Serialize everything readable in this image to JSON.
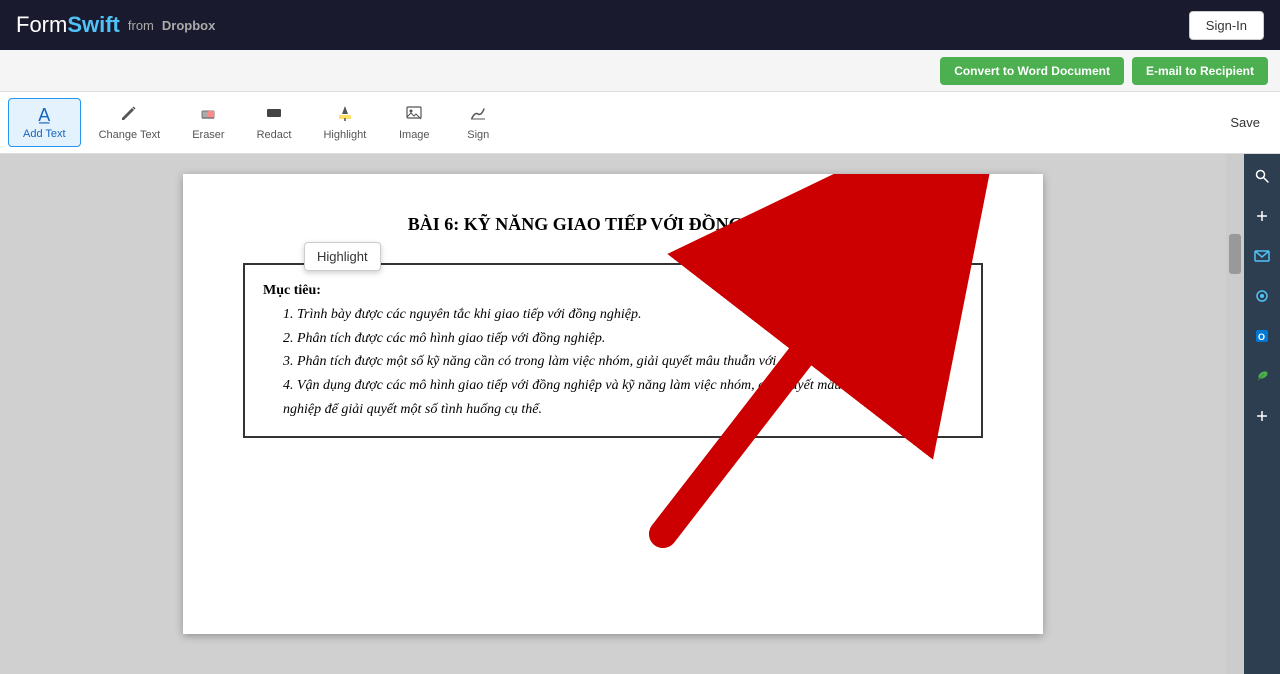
{
  "navbar": {
    "logo": {
      "form": "Form",
      "swift": "Swift",
      "from_label": "from",
      "dropbox": "Dropbox"
    },
    "signin_label": "Sign-In"
  },
  "action_bar": {
    "convert_label": "Convert to Word Document",
    "email_label": "E-mail to Recipient"
  },
  "toolbar": {
    "items": [
      {
        "id": "add-text",
        "label": "Add Text",
        "icon": "A",
        "active": true
      },
      {
        "id": "change-text",
        "label": "Change Text",
        "icon": "✎",
        "active": false
      },
      {
        "id": "eraser",
        "label": "Eraser",
        "icon": "◻",
        "active": false
      },
      {
        "id": "redact",
        "label": "Redact",
        "icon": "⬛",
        "active": false
      },
      {
        "id": "highlight",
        "label": "Highlight",
        "icon": "🖊",
        "active": false
      },
      {
        "id": "image",
        "label": "Image",
        "icon": "🖼",
        "active": false
      },
      {
        "id": "sign",
        "label": "Sign",
        "icon": "✒",
        "active": false
      }
    ],
    "save_label": "Save"
  },
  "side_panel": {
    "icons": [
      "✦",
      "✦",
      "●",
      "●",
      "●",
      "●",
      "+"
    ]
  },
  "document": {
    "title": "BÀI 6: KỸ NĂNG GIAO TIẾP VỚI ĐỒNG NGHIỆP",
    "box": {
      "heading": "Mục tiêu:",
      "items": [
        "1. Trình bày được các nguyên tắc khi giao tiếp với đồng nghiệp.",
        "2. Phân tích được các mô hình giao tiếp với đồng nghiệp.",
        "3. Phân tích được một số kỹ năng cần có trong làm việc nhóm, giải quyết mâu thuẫn với đồng nghiệp.",
        "4. Vận dụng được các mô hình giao tiếp với đồng nghiệp và kỹ năng làm việc nhóm, giải quyết mâu thuẫn với đồng nghiệp để giải quyết một số tình huống cụ thể."
      ]
    }
  },
  "highlight_tooltip": {
    "label": "Highlight"
  },
  "colors": {
    "navbar_bg": "#1a1a2e",
    "green_btn": "#4caf50",
    "active_toolbar": "#e3f2fd",
    "red_arrow": "#cc0000"
  }
}
